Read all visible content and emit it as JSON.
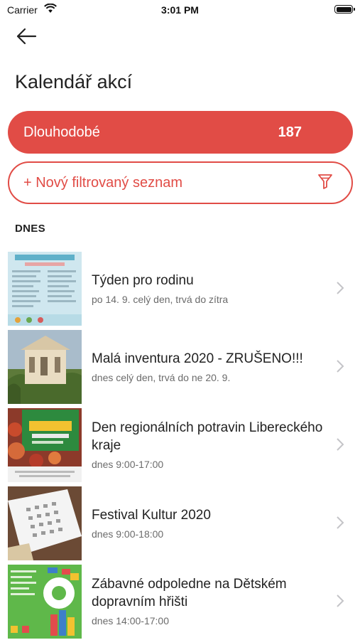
{
  "status_bar": {
    "carrier": "Carrier",
    "time": "3:01 PM"
  },
  "header": {
    "title": "Kalendář akcí"
  },
  "filters": {
    "long_term": {
      "label": "Dlouhodobé",
      "count": "187"
    },
    "new_filtered_list": {
      "label": "+ Nový filtrovaný seznam"
    }
  },
  "section": {
    "today_label": "DNES"
  },
  "events": [
    {
      "title": "Týden pro rodinu",
      "subtitle": "po 14. 9. celý den, trvá do zítra"
    },
    {
      "title": "Malá inventura 2020 - ZRUŠENO!!!",
      "subtitle": "dnes celý den, trvá do ne 20. 9."
    },
    {
      "title": "Den regionálních potravin Libereckého kraje",
      "subtitle": "dnes 9:00-17:00"
    },
    {
      "title": "Festival Kultur 2020",
      "subtitle": "dnes 9:00-18:00"
    },
    {
      "title": "Zábavné odpoledne na Dětském dopravním hřišti",
      "subtitle": "dnes 14:00-17:00"
    }
  ],
  "icons": {
    "back": "arrow-left-icon",
    "filter": "funnel-icon",
    "chevron": "chevron-right-icon"
  },
  "colors": {
    "accent": "#e14c46",
    "subtitle": "#6b6b6b"
  }
}
